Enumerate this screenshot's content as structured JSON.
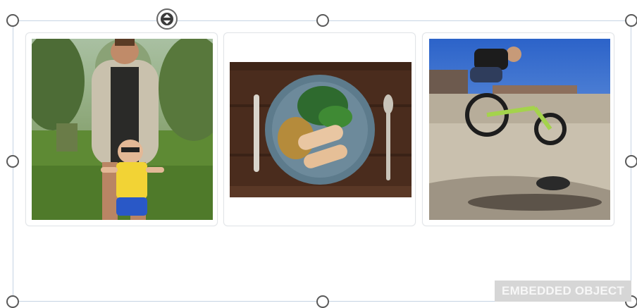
{
  "embedded_object": {
    "badge_label": "EMBEDDED OBJECT",
    "photos": [
      {
        "subject": "woman-and-baby-outdoors"
      },
      {
        "subject": "plate-of-food-with-cutlery"
      },
      {
        "subject": "bmx-rider-jumping"
      }
    ]
  },
  "colors": {
    "frame_border": "#c6d4e3",
    "handle_stroke": "#5a5a5a",
    "badge_background": "#d6d6d6"
  }
}
